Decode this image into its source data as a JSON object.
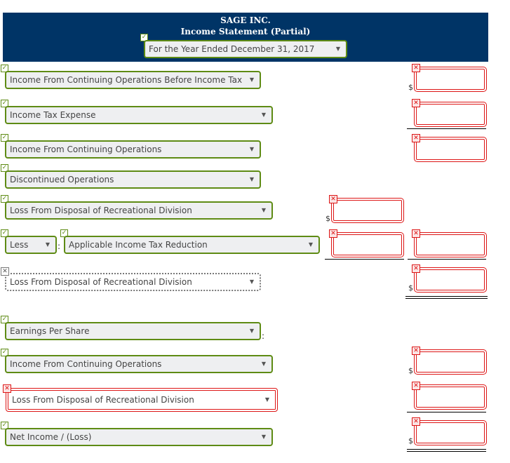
{
  "header": {
    "company": "SAGE INC.",
    "statement": "Income Statement (Partial)",
    "period": "For the Year Ended December 31, 2017",
    "period_status": "correct"
  },
  "rows": [
    {
      "label": "Income From Continuing Operations Before Income Tax",
      "status": "correct"
    },
    {
      "label": "Income Tax Expense",
      "status": "correct"
    },
    {
      "label": "Income From Continuing Operations",
      "status": "correct"
    },
    {
      "label": "Discontinued Operations",
      "status": "correct"
    },
    {
      "label": "Loss From Disposal of Recreational Division",
      "status": "correct"
    },
    {
      "prefix": "Less",
      "label": "Applicable Income Tax Reduction",
      "status": "correct"
    },
    {
      "label": "Loss From Disposal of Recreational Division",
      "status": "unanswered"
    },
    {
      "label": "Earnings Per Share",
      "status": "correct"
    },
    {
      "label": "Income From Continuing Operations",
      "status": "correct"
    },
    {
      "label": "Loss From Disposal of Recreational Division",
      "status": "incorrect"
    },
    {
      "label": "Net Income / (Loss)",
      "status": "correct"
    }
  ],
  "symbols": {
    "dollar": "$",
    "colon": ":",
    "check": "✓",
    "cross": "✕",
    "arrow": "▼"
  },
  "amount_inputs": {
    "value": "",
    "status": "incorrect"
  }
}
